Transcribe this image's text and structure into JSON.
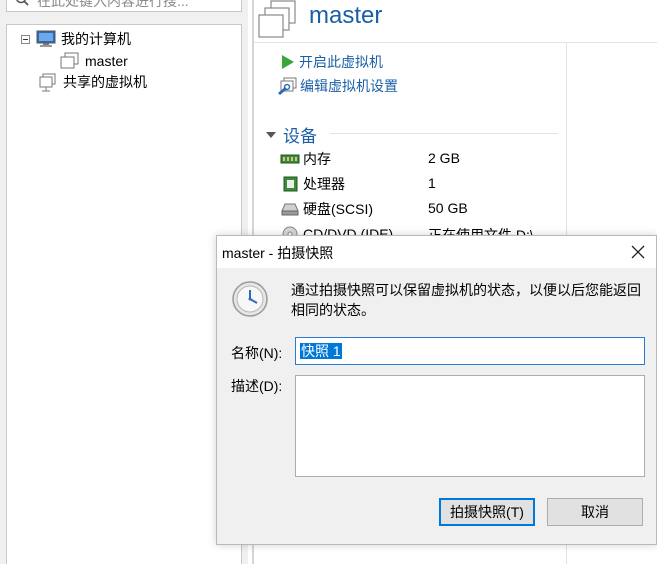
{
  "library": {
    "search_placeholder": "在此处键入内容进行搜...",
    "tree": [
      {
        "label": "我的计算机",
        "icon": "computer-icon"
      },
      {
        "label": "master",
        "icon": "vm-icon"
      },
      {
        "label": "共享的虚拟机",
        "icon": "shared-vm-icon"
      }
    ]
  },
  "vm": {
    "title": "master",
    "actions": {
      "power_on": "开启此虚拟机",
      "edit_settings": "编辑虚拟机设置"
    },
    "devices_header": "设备",
    "devices": [
      {
        "name": "内存",
        "value": "2 GB",
        "icon": "memory-icon"
      },
      {
        "name": "处理器",
        "value": "1",
        "icon": "cpu-icon"
      },
      {
        "name": "硬盘(SCSI)",
        "value": "50 GB",
        "icon": "hdd-icon"
      },
      {
        "name": "CD/DVD (IDE)",
        "value": "正在使用文件 D:\\",
        "icon": "cd-icon"
      }
    ]
  },
  "dialog": {
    "title": "master - 拍摄快照",
    "message": "通过拍摄快照可以保留虚拟机的状态，以便以后您能返回相同的状态。",
    "name_label": "名称(N):",
    "name_value": "快照 1",
    "desc_label": "描述(D):",
    "desc_value": "",
    "ok_label": "拍摄快照(T)",
    "cancel_label": "取消"
  },
  "colors": {
    "accent_blue": "#1a5fa8",
    "play_green": "#3aa63a",
    "selection_blue": "#0078d7"
  }
}
